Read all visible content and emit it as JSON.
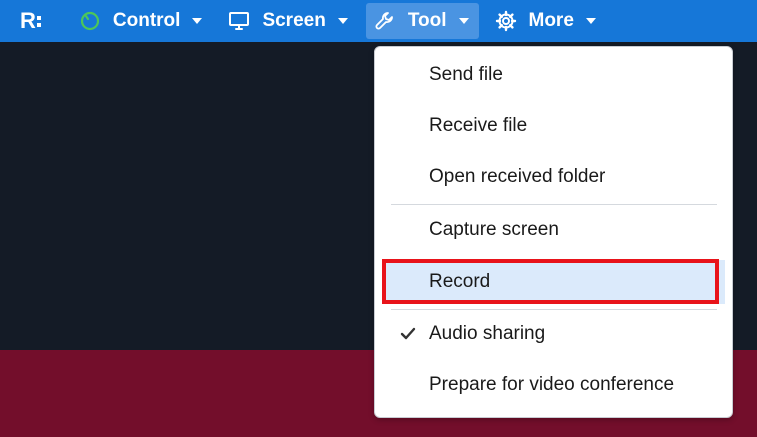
{
  "toolbar": {
    "logo_text": "R",
    "items": [
      {
        "label": "Control",
        "icon": "control-icon"
      },
      {
        "label": "Screen",
        "icon": "monitor-icon"
      },
      {
        "label": "Tool",
        "icon": "wrench-icon",
        "active": true
      },
      {
        "label": "More",
        "icon": "gear-icon"
      }
    ]
  },
  "colors": {
    "toolbar_bg": "#1677d8",
    "toolbar_active_bg": "#4a94e2",
    "remote_dark": "#141b26",
    "remote_maroon": "#730e2b",
    "menu_highlight": "#dbeafb",
    "annotation_red": "#e8131a",
    "control_icon_green": "#4cc65a"
  },
  "tool_menu": {
    "items": [
      {
        "label": "Send file"
      },
      {
        "label": "Receive file"
      },
      {
        "label": "Open received folder"
      },
      {
        "label": "Capture screen"
      },
      {
        "label": "Record",
        "highlighted": true
      },
      {
        "label": "Audio sharing",
        "checked": true
      },
      {
        "label": "Prepare for video conference"
      }
    ]
  }
}
